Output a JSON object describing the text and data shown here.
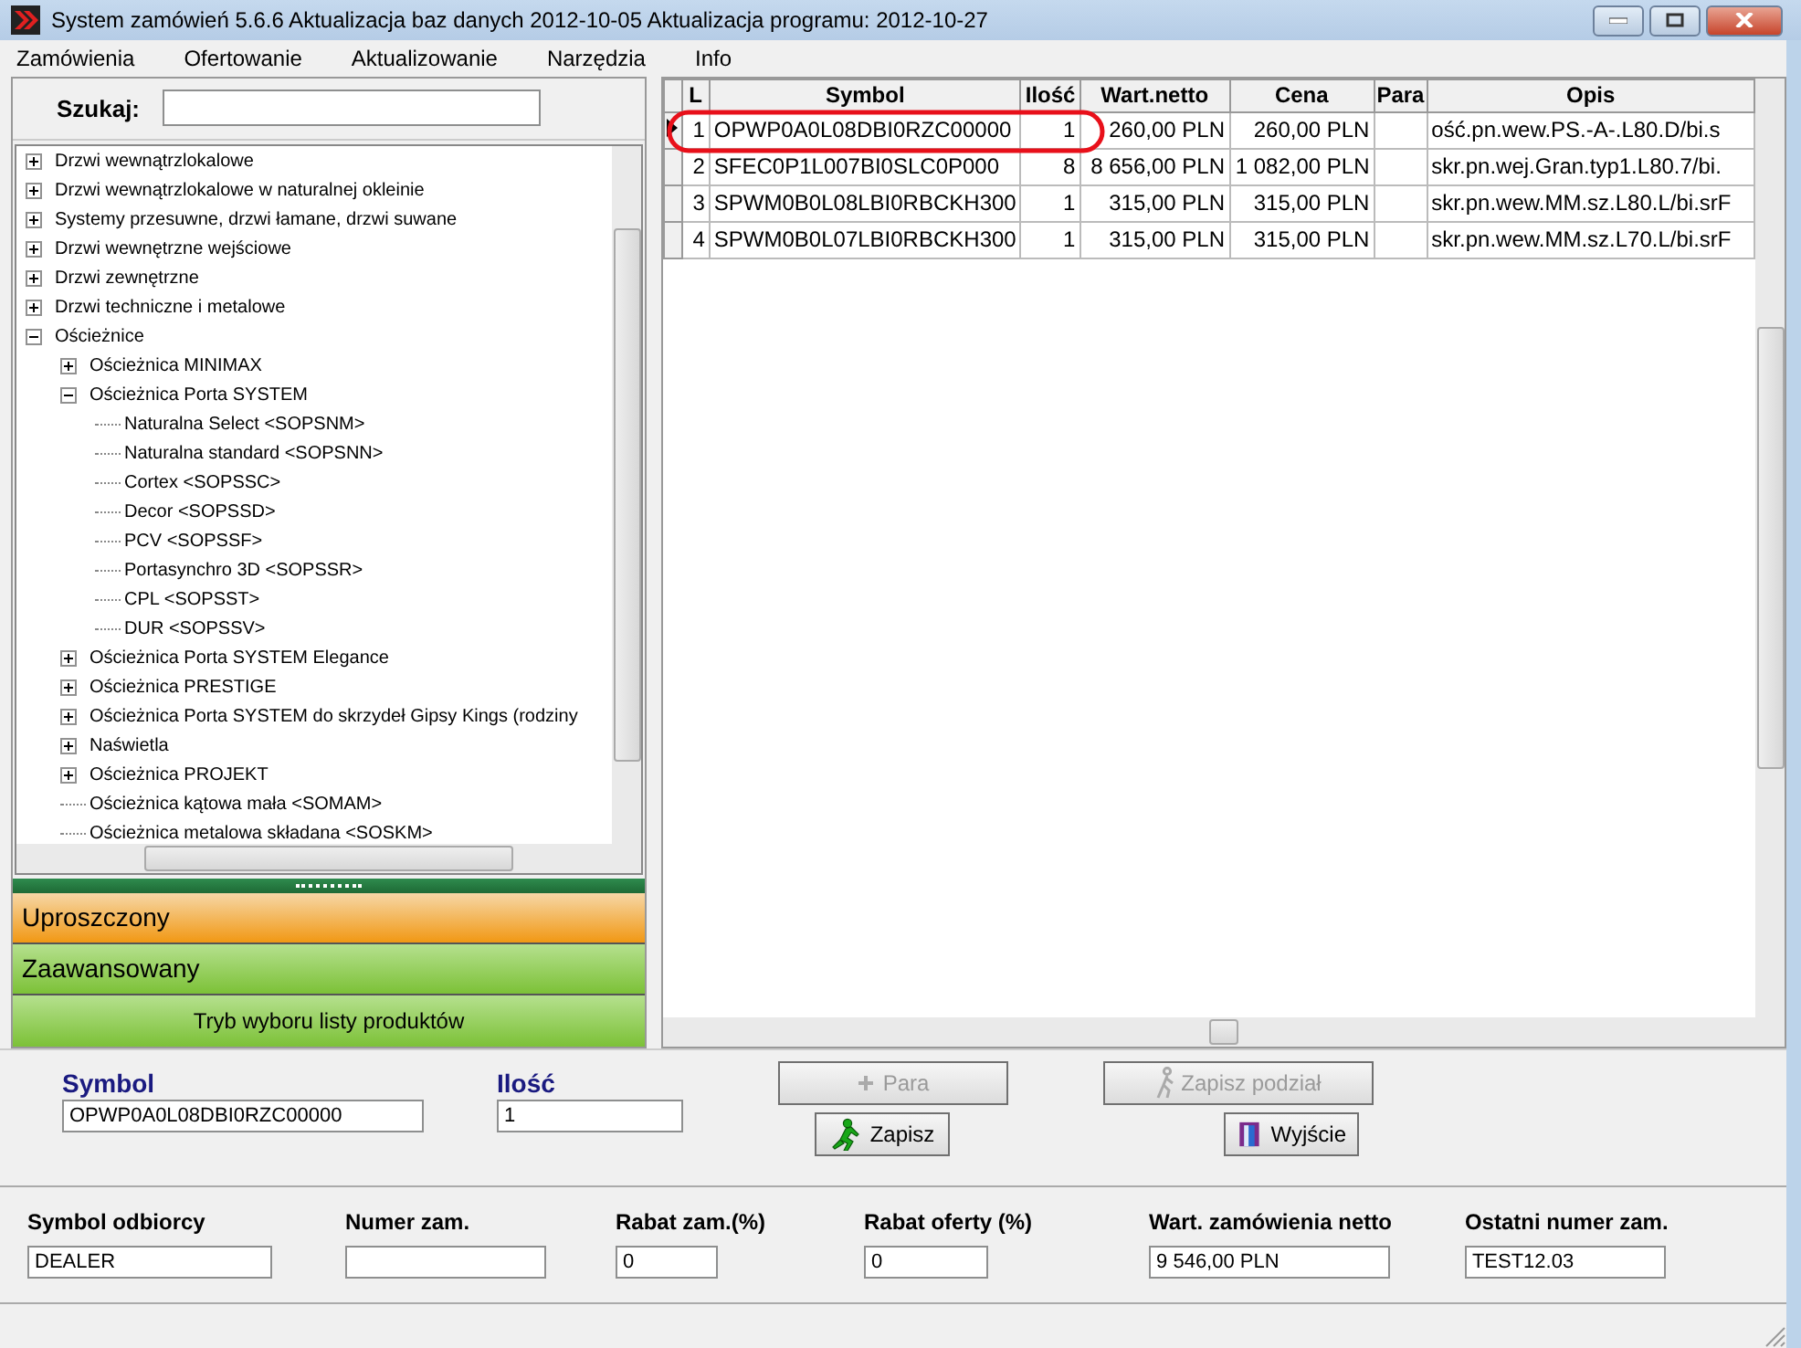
{
  "window": {
    "title": "System zamówień 5.6.6  Aktualizacja baz danych 2012-10-05  Aktualizacja programu: 2012-10-27"
  },
  "menu": [
    {
      "label": "Zamówienia"
    },
    {
      "label": "Ofertowanie"
    },
    {
      "label": "Aktualizowanie"
    },
    {
      "label": "Narzędzia"
    },
    {
      "label": "Info"
    }
  ],
  "search": {
    "label": "Szukaj:"
  },
  "tree": [
    {
      "label": "Drzwi wewnątrzlokalowe",
      "kind": "folder",
      "expanded": false
    },
    {
      "label": "Drzwi wewnątrzlokalowe w naturalnej okleinie",
      "kind": "folder",
      "expanded": false
    },
    {
      "label": "Systemy przesuwne, drzwi łamane, drzwi suwane",
      "kind": "folder",
      "expanded": false
    },
    {
      "label": "Drzwi wewnętrzne wejściowe",
      "kind": "folder",
      "expanded": false
    },
    {
      "label": "Drzwi zewnętrzne",
      "kind": "folder",
      "expanded": false
    },
    {
      "label": "Drzwi techniczne i metalowe",
      "kind": "folder",
      "expanded": false
    },
    {
      "label": "Ościeżnice",
      "kind": "folder",
      "expanded": true,
      "children": [
        {
          "label": "Ościeżnica MINIMAX",
          "kind": "folder",
          "expanded": false
        },
        {
          "label": "Ościeżnica Porta SYSTEM",
          "kind": "folder",
          "expanded": true,
          "children": [
            {
              "label": "Naturalna Select <SOPSNM>",
              "kind": "leaf"
            },
            {
              "label": "Naturalna standard <SOPSNN>",
              "kind": "leaf"
            },
            {
              "label": "Cortex <SOPSSC>",
              "kind": "leaf"
            },
            {
              "label": "Decor <SOPSSD>",
              "kind": "leaf"
            },
            {
              "label": "PCV <SOPSSF>",
              "kind": "leaf"
            },
            {
              "label": "Portasynchro 3D <SOPSSR>",
              "kind": "leaf"
            },
            {
              "label": "CPL <SOPSST>",
              "kind": "leaf"
            },
            {
              "label": "DUR <SOPSSV>",
              "kind": "leaf"
            }
          ]
        },
        {
          "label": "Ościeżnica Porta SYSTEM Elegance",
          "kind": "folder",
          "expanded": false
        },
        {
          "label": "Ościeżnica PRESTIGE",
          "kind": "folder",
          "expanded": false
        },
        {
          "label": "Ościeżnica Porta SYSTEM do skrzydeł Gipsy Kings (rodziny",
          "kind": "folder",
          "expanded": false
        },
        {
          "label": "Naświetla",
          "kind": "folder",
          "expanded": false
        },
        {
          "label": "Ościeżnica PROJEKT",
          "kind": "folder",
          "expanded": false
        },
        {
          "label": "Ościeżnica kątowa mała <SOMAM>",
          "kind": "leaf"
        },
        {
          "label": "Ościeżnica metalowa składana <SOSKM>",
          "kind": "leaf"
        }
      ]
    }
  ],
  "modes": [
    {
      "label": "Uproszczony",
      "selected": true
    },
    {
      "label": "Zaawansowany",
      "selected": false
    }
  ],
  "mode_list_button": "Tryb wyboru listy produktów",
  "table": {
    "columns": [
      "L",
      "Symbol",
      "Ilość",
      "Wart.netto",
      "Cena",
      "Para",
      "Opis"
    ],
    "rows": [
      {
        "selected": true,
        "cells": [
          "1",
          "OPWP0A0L08DBI0RZC00000",
          "1",
          "260,00 PLN",
          "260,00 PLN",
          "",
          "ość.pn.wew.PS.-A-.L80.D/bi.s"
        ]
      },
      {
        "selected": false,
        "cells": [
          "2",
          "SFEC0P1L007BI0SLC0P000",
          "8",
          "8 656,00 PLN",
          "1 082,00 PLN",
          "",
          "skr.pn.wej.Gran.typ1.L80.7/bi."
        ]
      },
      {
        "selected": false,
        "cells": [
          "3",
          "SPWM0B0L08LBI0RBCKH300",
          "1",
          "315,00 PLN",
          "315,00 PLN",
          "",
          "skr.pn.wew.MM.sz.L80.L/bi.srF"
        ]
      },
      {
        "selected": false,
        "cells": [
          "4",
          "SPWM0B0L07LBI0RBCKH300",
          "1",
          "315,00 PLN",
          "315,00 PLN",
          "",
          "skr.pn.wew.MM.sz.L70.L/bi.srF"
        ]
      }
    ]
  },
  "entry": {
    "symbol_label": "Symbol",
    "symbol_value": "OPWP0A0L08DBI0RZC00000",
    "qty_label": "Ilość",
    "qty_value": "1"
  },
  "buttons": [
    {
      "label": "Para",
      "kind": "plus",
      "disabled": true
    },
    {
      "label": "Zapisz podział",
      "kind": "walk",
      "disabled": true
    },
    {
      "label": "Zapisz",
      "kind": "run",
      "disabled": false
    },
    {
      "label": "Wyjście",
      "kind": "door",
      "disabled": false
    }
  ],
  "summary": [
    {
      "label": "Symbol odbiorcy",
      "value": "DEALER"
    },
    {
      "label": "Numer zam."
    },
    {
      "label": "Rabat zam.(%)",
      "value": "0"
    },
    {
      "label": "Rabat oferty (%)",
      "value": "0"
    },
    {
      "label": "Wart. zamówienia netto",
      "value": "9 546,00 PLN"
    },
    {
      "label": "Ostatni numer zam.",
      "value": "TEST12.03"
    }
  ]
}
